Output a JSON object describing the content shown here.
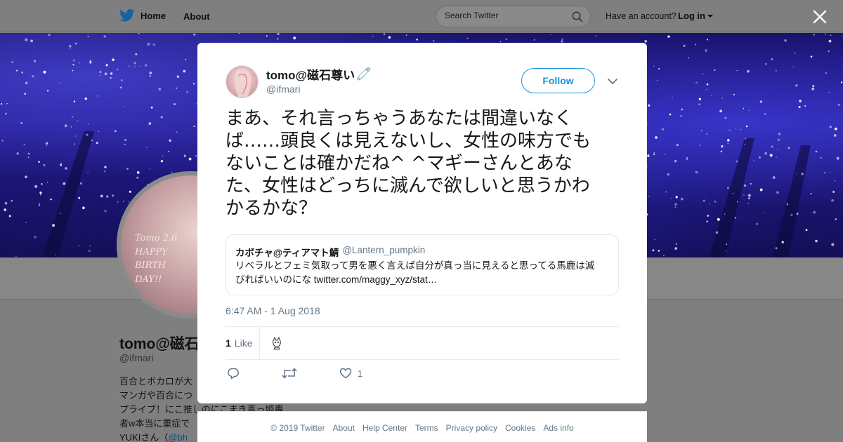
{
  "nav": {
    "home_label": "Home",
    "about_label": "About",
    "search_placeholder": "Search Twitter",
    "have_account": "Have an account?",
    "login_label": "Log in"
  },
  "profile": {
    "name": "tomo@磁石",
    "handle": "@ifmari",
    "bio_lines": [
      "百合とボカロが大",
      "マンガや百合につ",
      "プライブ！にこ推しのにこまき真っ姫専",
      "者w本当に重症で"
    ],
    "bio_last_prefix": "YUKIさん（",
    "bio_last_link": "@bh",
    "avatar_text_lines": [
      "Tomo 2.6",
      "HAPPY",
      "BIRTH",
      "DAY!!"
    ]
  },
  "tweet": {
    "author_name": "tomo@磁石尊い",
    "author_emoji": "🧷",
    "author_handle": "@ifmari",
    "follow_label": "Follow",
    "text": "まあ、それ言っちゃうあなたは間違いなくば……頭良くは見えないし、女性の味方でもないことは確かだね^ ^マギーさんとあなた、女性はどっちに滅んで欲しいと思うかわかるかな？",
    "text_lines": [
      "まあ、それ言っちゃうあなたは間違いなく",
      "ば……頭良くは見えないし、女性の味方でも",
      "ないことは確かだね^ ^マギーさんとあな",
      "た、女性はどっちに滅んで欲しいと思うかわ",
      "かるかな？"
    ],
    "quote": {
      "name": "カボチャ@ティアマト鯖",
      "handle": "@Lantern_pumpkin",
      "body_line1": "リベラルとフェミ気取って男を悪く言えば自分が真っ当に見えると思ってる馬鹿は滅",
      "body_line2": "びればいいのにな twitter.com/maggy_xyz/stat…"
    },
    "timestamp": "6:47 AM - 1 Aug 2018",
    "likes_count": "1",
    "likes_label": "Like",
    "action_like_count": "1"
  },
  "footer": {
    "links": [
      "© 2019 Twitter",
      "About",
      "Help Center",
      "Terms",
      "Privacy policy",
      "Cookies",
      "Ads info"
    ]
  },
  "colors": {
    "twitter_blue": "#1b95e0",
    "overlay_gray": "#7f7f7f",
    "secondary_text": "#657786"
  },
  "icons": [
    "twitter-bird-icon",
    "search-icon",
    "close-icon",
    "chevron-down-icon",
    "reply-icon",
    "retweet-icon",
    "heart-icon"
  ]
}
